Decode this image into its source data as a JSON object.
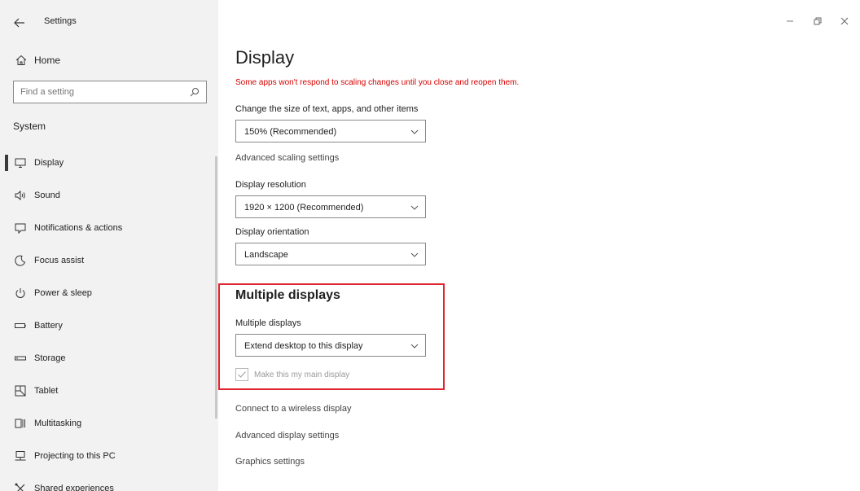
{
  "window": {
    "title": "Settings",
    "minimize_icon": "minimize-icon",
    "restore_icon": "restore-icon",
    "close_icon": "close-icon"
  },
  "sidebar": {
    "home_label": "Home",
    "search_placeholder": "Find a setting",
    "section_label": "System",
    "items": [
      {
        "label": "Display",
        "icon": "monitor-icon",
        "selected": true
      },
      {
        "label": "Sound",
        "icon": "speaker-icon",
        "selected": false
      },
      {
        "label": "Notifications & actions",
        "icon": "notification-icon",
        "selected": false
      },
      {
        "label": "Focus assist",
        "icon": "moon-icon",
        "selected": false
      },
      {
        "label": "Power & sleep",
        "icon": "power-icon",
        "selected": false
      },
      {
        "label": "Battery",
        "icon": "battery-icon",
        "selected": false
      },
      {
        "label": "Storage",
        "icon": "storage-icon",
        "selected": false
      },
      {
        "label": "Tablet",
        "icon": "tablet-icon",
        "selected": false
      },
      {
        "label": "Multitasking",
        "icon": "multitasking-icon",
        "selected": false
      },
      {
        "label": "Projecting to this PC",
        "icon": "projecting-icon",
        "selected": false
      },
      {
        "label": "Shared experiences",
        "icon": "shared-icon",
        "selected": false
      }
    ]
  },
  "main": {
    "page_title": "Display",
    "warning": "Some apps won't respond to scaling changes until you close and reopen them.",
    "scale_label": "Change the size of text, apps, and other items",
    "scale_value": "150% (Recommended)",
    "advanced_scaling_link": "Advanced scaling settings",
    "resolution_label": "Display resolution",
    "resolution_value": "1920 × 1200 (Recommended)",
    "orientation_label": "Display orientation",
    "orientation_value": "Landscape",
    "multiple_heading": "Multiple displays",
    "multiple_label": "Multiple displays",
    "multiple_value": "Extend desktop to this display",
    "main_display_checkbox": "Make this my main display",
    "main_display_checked": true,
    "links": {
      "wireless": "Connect to a wireless display",
      "advanced_display": "Advanced display settings",
      "graphics": "Graphics settings"
    }
  },
  "colors": {
    "sidebar_bg": "#f2f2f2",
    "warning": "#d60000",
    "highlight_border": "#e0232e"
  }
}
